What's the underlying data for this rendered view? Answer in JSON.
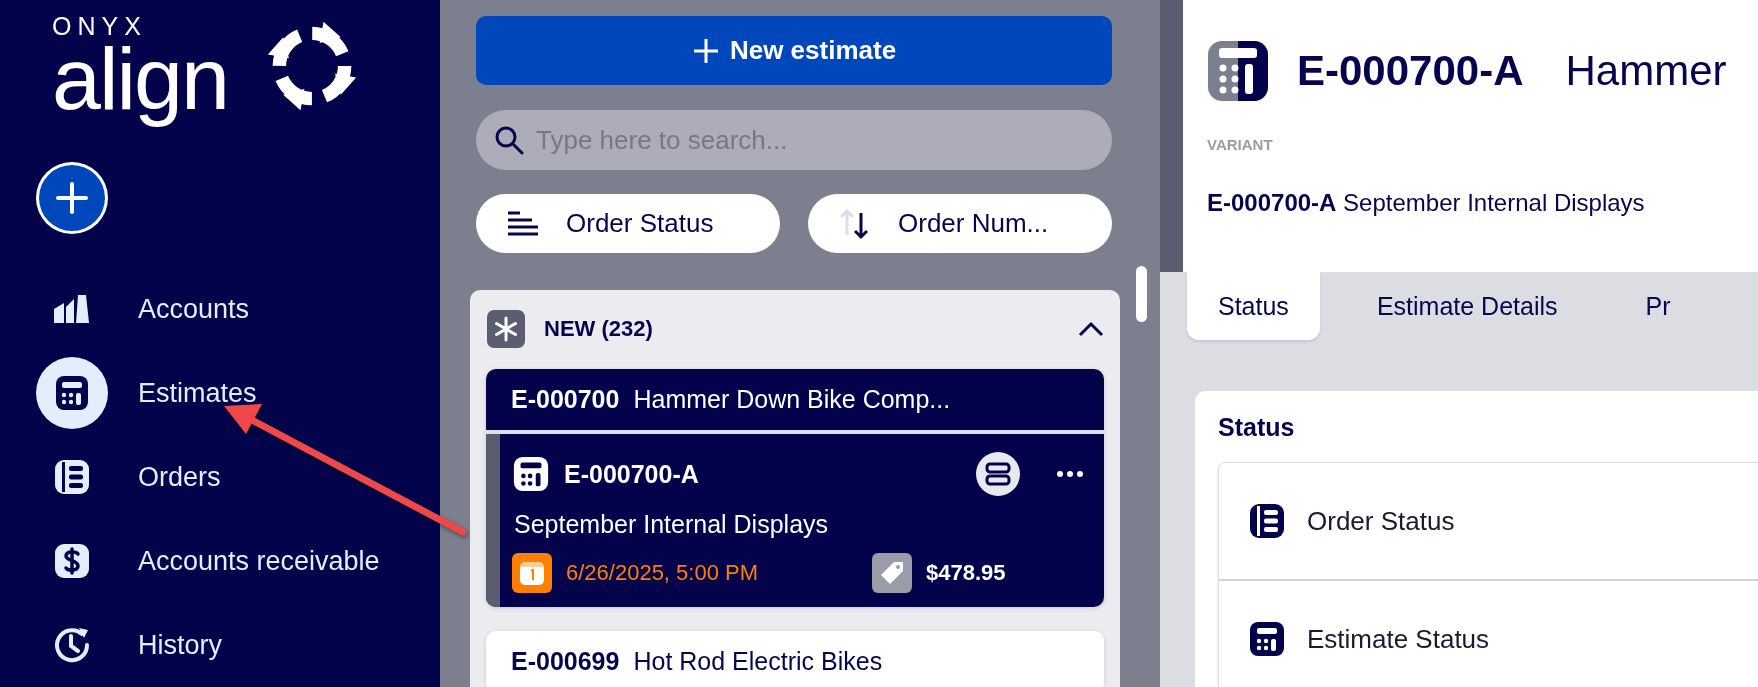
{
  "logo": {
    "brand": "ONYX",
    "product": "align"
  },
  "sidebar": {
    "items": [
      {
        "label": "Accounts",
        "kind": "factory",
        "selected": false
      },
      {
        "label": "Estimates",
        "kind": "calculator",
        "selected": true
      },
      {
        "label": "Orders",
        "kind": "orders",
        "selected": false
      },
      {
        "label": "Accounts receivable",
        "kind": "dollar",
        "selected": false
      },
      {
        "label": "History",
        "kind": "history",
        "selected": false
      }
    ]
  },
  "new_button": "New estimate",
  "search": {
    "placeholder": "Type here to search..."
  },
  "filters": [
    {
      "label": "Order Status",
      "kind": "group"
    },
    {
      "label": "Order Num...",
      "kind": "sort"
    }
  ],
  "group": {
    "label": "NEW (232)",
    "expanded": true,
    "orders": [
      {
        "number": "E-000700",
        "name": "Hammer Down Bike Comp...",
        "selected": true,
        "variants": [
          {
            "number": "E-000700-A",
            "name": "September Internal Displays",
            "due": "6/26/2025, 5:00 PM",
            "price": "$478.95"
          }
        ]
      },
      {
        "number": "E-000699",
        "name": "Hot Rod Electric Bikes",
        "selected": false
      }
    ]
  },
  "detail": {
    "number": "E-000700-A",
    "title": "Hammer",
    "variant_label": "VARIANT",
    "variant": "**E-000700-A** September Internal Displays",
    "tabs": [
      {
        "label": "Status",
        "selected": true
      },
      {
        "label": "Estimate Details",
        "selected": false
      },
      {
        "label": "Pr",
        "selected": false
      }
    ],
    "section": {
      "title": "Status",
      "rows": [
        {
          "label": "Order Status",
          "kind": "orders"
        },
        {
          "label": "Estimate Status",
          "kind": "calculator"
        }
      ]
    }
  }
}
